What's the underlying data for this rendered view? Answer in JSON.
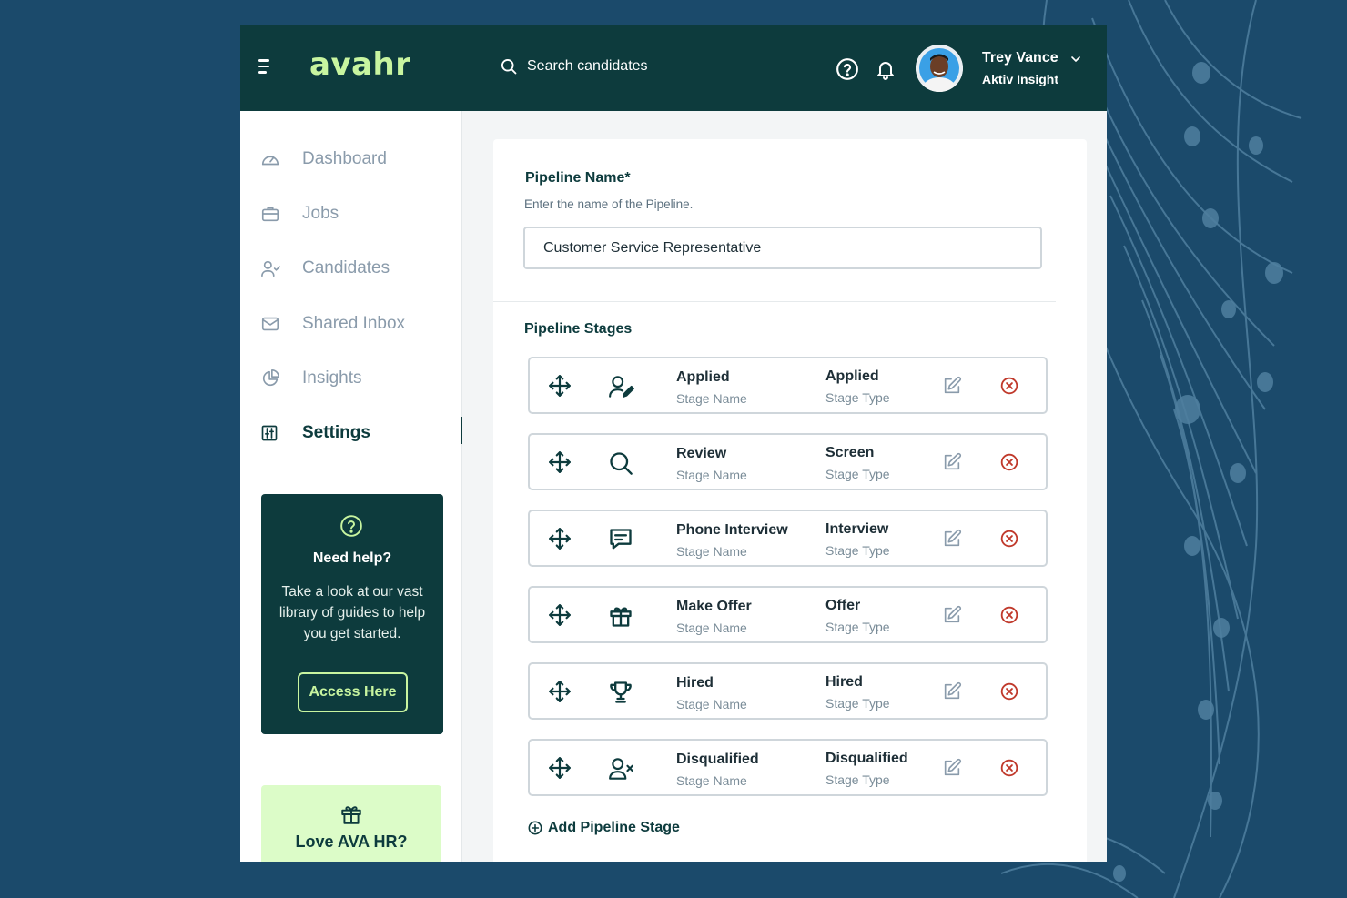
{
  "header": {
    "logo_text": "avahr",
    "search_placeholder": "Search candidates",
    "user_name": "Trey Vance",
    "user_org": "Aktiv Insight"
  },
  "sidebar": {
    "items": [
      {
        "label": "Dashboard",
        "icon": "dashboard-gauge-icon"
      },
      {
        "label": "Jobs",
        "icon": "briefcase-icon"
      },
      {
        "label": "Candidates",
        "icon": "user-check-icon"
      },
      {
        "label": "Shared Inbox",
        "icon": "mail-icon"
      },
      {
        "label": "Insights",
        "icon": "pie-chart-icon"
      },
      {
        "label": "Settings",
        "icon": "sliders-icon",
        "active": true
      }
    ],
    "help": {
      "title": "Need help?",
      "text": "Take a look at our vast library of guides to help you get started.",
      "button": "Access Here"
    },
    "love": {
      "title": "Love AVA HR?"
    }
  },
  "form": {
    "pipeline_name_label": "Pipeline Name*",
    "pipeline_name_hint": "Enter the name of the Pipeline.",
    "pipeline_name_value": "Customer Service Representative",
    "stages_label": "Pipeline Stages",
    "stages": [
      {
        "name": "Applied",
        "name_label": "Stage Name",
        "type": "Applied",
        "type_label": "Stage Type",
        "icon": "user-edit-icon"
      },
      {
        "name": "Review",
        "name_label": "Stage Name",
        "type": "Screen",
        "type_label": "Stage Type",
        "icon": "search-icon"
      },
      {
        "name": "Phone Interview",
        "name_label": "Stage Name",
        "type": "Interview",
        "type_label": "Stage Type",
        "icon": "chat-icon"
      },
      {
        "name": "Make Offer",
        "name_label": "Stage Name",
        "type": "Offer",
        "type_label": "Stage Type",
        "icon": "gift-icon"
      },
      {
        "name": "Hired",
        "name_label": "Stage Name",
        "type": "Hired",
        "type_label": "Stage Type",
        "icon": "trophy-icon"
      },
      {
        "name": "Disqualified",
        "name_label": "Stage Name",
        "type": "Disqualified",
        "type_label": "Stage Type",
        "icon": "user-x-icon"
      }
    ],
    "add_stage_label": "Add Pipeline Stage"
  },
  "colors": {
    "background": "#1b4a6b",
    "header": "#0d3b3d",
    "accent": "#c8f5a0",
    "delete": "#c0392b"
  }
}
